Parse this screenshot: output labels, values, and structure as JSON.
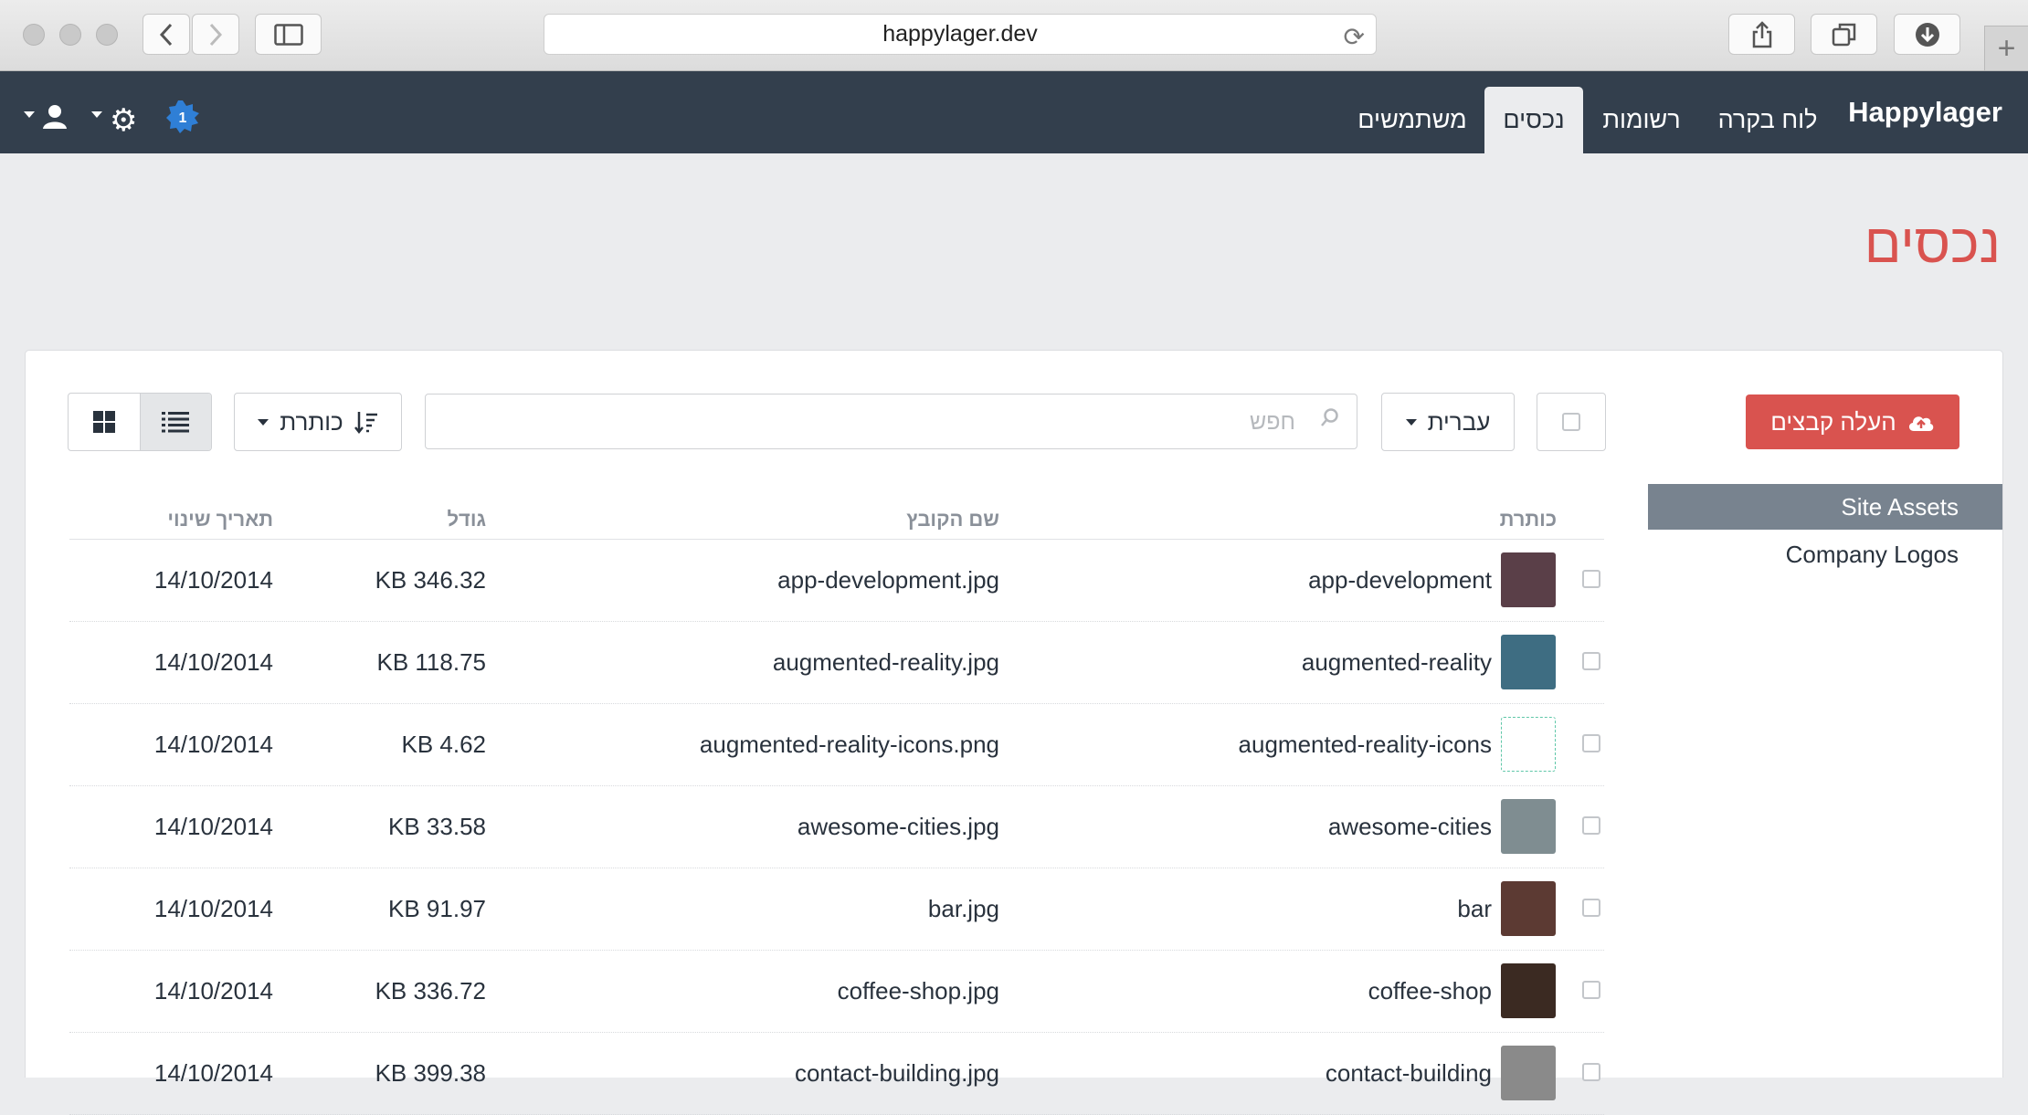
{
  "browser": {
    "url": "happylager.dev",
    "new_tab_icon": "plus-icon"
  },
  "app": {
    "brand": "Happylager",
    "nav": [
      {
        "label": "לוח בקרה",
        "active": false
      },
      {
        "label": "רשומות",
        "active": false
      },
      {
        "label": "נכסים",
        "active": true
      },
      {
        "label": "משתמשים",
        "active": false
      }
    ],
    "badge_count": "1",
    "accent_color": "#d9534f",
    "header_color": "#333f4d"
  },
  "page": {
    "title": "נכסים"
  },
  "toolbar": {
    "upload_label": "העלה קבצים",
    "locale_label": "עברית",
    "search_placeholder": "חפש",
    "sort_label": "כותרת"
  },
  "sources": [
    {
      "label": "Site Assets",
      "selected": true
    },
    {
      "label": "Company Logos",
      "selected": false
    }
  ],
  "table": {
    "headers": {
      "title": "כותרת",
      "filename": "שם הקובץ",
      "size": "גודל",
      "date": "תאריך שינוי"
    },
    "rows": [
      {
        "title": "app-development",
        "filename": "app-development.jpg",
        "size": "KB 346.32",
        "date": "14/10/2014",
        "thumb_color": "#5a3f48"
      },
      {
        "title": "augmented-reality",
        "filename": "augmented-reality.jpg",
        "size": "KB 118.75",
        "date": "14/10/2014",
        "thumb_color": "#3e6d82"
      },
      {
        "title": "augmented-reality-icons",
        "filename": "augmented-reality-icons.png",
        "size": "KB 4.62",
        "date": "14/10/2014",
        "thumb_color": "#ffffff"
      },
      {
        "title": "awesome-cities",
        "filename": "awesome-cities.jpg",
        "size": "KB 33.58",
        "date": "14/10/2014",
        "thumb_color": "#7f8d91"
      },
      {
        "title": "bar",
        "filename": "bar.jpg",
        "size": "KB 91.97",
        "date": "14/10/2014",
        "thumb_color": "#5c3a33"
      },
      {
        "title": "coffee-shop",
        "filename": "coffee-shop.jpg",
        "size": "KB 336.72",
        "date": "14/10/2014",
        "thumb_color": "#3b2a22"
      },
      {
        "title": "contact-building",
        "filename": "contact-building.jpg",
        "size": "KB 399.38",
        "date": "14/10/2014",
        "thumb_color": "#8a8a8a"
      }
    ]
  }
}
